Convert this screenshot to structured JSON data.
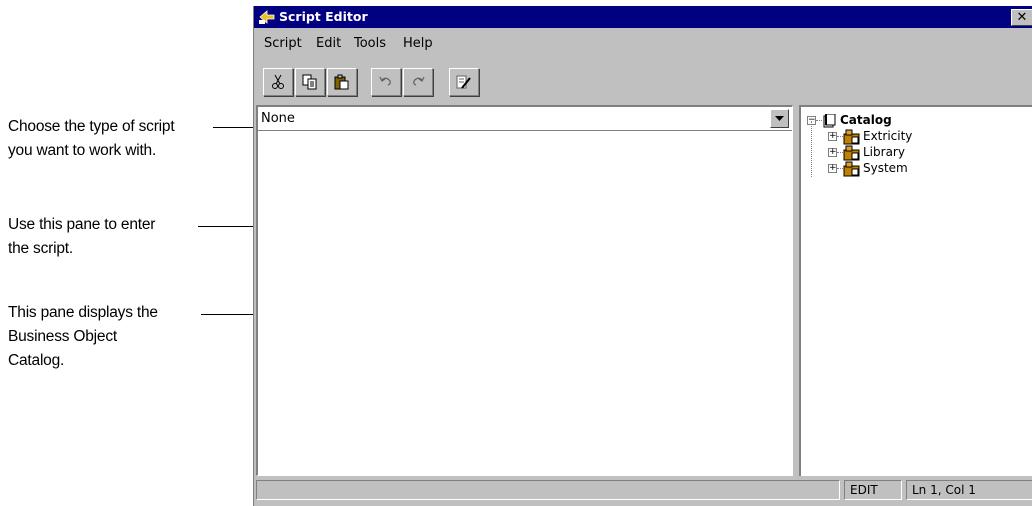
{
  "window": {
    "title": "Script Editor",
    "close_label": "✕"
  },
  "menu": [
    "Script",
    "Edit",
    "Tools",
    "Help"
  ],
  "toolbar": {
    "buttons": [
      "cut-icon",
      "copy-icon",
      "paste-icon",
      "undo-icon",
      "redo-icon",
      "edit-script-icon"
    ]
  },
  "script_type": {
    "selected": "None"
  },
  "catalog": {
    "root": "Catalog",
    "items": [
      "Extricity",
      "Library",
      "System"
    ]
  },
  "status": {
    "message": "",
    "mode": "EDIT",
    "position": "Ln 1, Col 1"
  },
  "callouts": [
    [
      "Choose the type of script",
      "you want to work with."
    ],
    [
      "Use this pane to enter",
      "the script."
    ],
    [
      "This pane displays the",
      "Business Object",
      "Catalog."
    ]
  ],
  "colors": {
    "title_bar": "#000080",
    "window_face": "#c0c0c0"
  }
}
